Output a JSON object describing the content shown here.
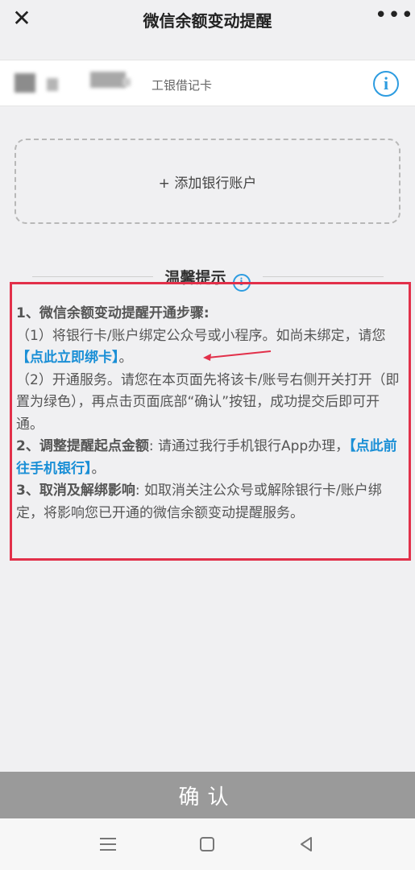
{
  "header": {
    "title": "微信余额变动提醒",
    "close_label": "✕",
    "more_label": "•••"
  },
  "card": {
    "name": "工银借记卡",
    "info_label": "i"
  },
  "add_account": {
    "label": "+ 添加银行账户"
  },
  "tips": {
    "title": "温馨提示",
    "info_label": "i",
    "s1_title": "1、微信余额变动提醒开通步骤:",
    "s1_step1_text": "（1）将银行卡/账户绑定公众号或小程序。如尚未绑定，请您",
    "s1_step1_link": "【点此立即绑卡】",
    "s1_step1_end": "。",
    "s1_step2_text": "（2）开通服务。请您在本页面先将该卡/账号右侧开关打开（即置为绿色），再点击页面底部“确认”按钮，成功提交后即可开通。",
    "s2_title": "2、调整提醒起点金额",
    "s2_text": ": 请通过我行手机银行App办理，",
    "s2_link": "【点此前往手机银行】",
    "s2_end": "。",
    "s3_title": "3、取消及解绑影响",
    "s3_text": ": 如取消关注公众号或解除银行卡/账户绑定，将影响您已开通的微信余额变动提醒服务。"
  },
  "confirm": {
    "label": "确认"
  },
  "colors": {
    "accent_blue": "#2d9ce0",
    "link_blue": "#1a8fd6",
    "annotation_red": "#e2304a",
    "confirm_gray": "#9a9a9a"
  },
  "icons": [
    "close-icon",
    "more-icon",
    "info-icon",
    "menu-icon",
    "home-icon",
    "back-icon"
  ]
}
